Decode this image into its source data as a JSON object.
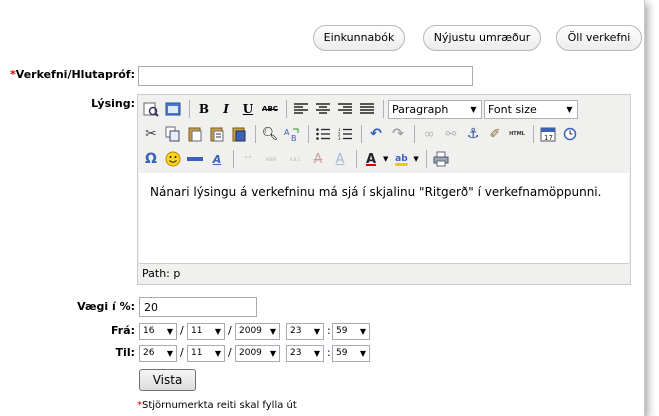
{
  "nav": {
    "gradebook": "Einkunnabók",
    "latest_discussions": "Nýjustu umræður",
    "all_assignments": "Öll verkefni"
  },
  "form": {
    "required_marker": "*",
    "assignment_label": "Verkefni/Hlutapróf:",
    "assignment_value": "",
    "description_label": "Lýsing:",
    "weight_label": "Vægi í %:",
    "weight_value": "20",
    "from_label": "Frá:",
    "to_label": "Til:",
    "from": {
      "day": "16",
      "month": "11",
      "year": "2009",
      "hour": "23",
      "minute": "59"
    },
    "to": {
      "day": "26",
      "month": "11",
      "year": "2009",
      "hour": "23",
      "minute": "59"
    },
    "date_separator": "/",
    "time_separator": ":",
    "submit_label": "Vista",
    "required_note": "Stjörnumerkta reiti skal fylla út"
  },
  "editor": {
    "format_select": "Paragraph",
    "fontsize_select": "Font size",
    "content": "Nánari lýsingu á verkefninu má sjá í skjalinu \"Ritgerð\" í verkefnamöppunni.",
    "path_label": "Path: p",
    "toolbar_text": {
      "bold": "B",
      "italic": "I",
      "underline": "U",
      "strike": "ABC",
      "html": "HTML",
      "omega": "Ω",
      "quote": "“”",
      "abbr": "ABBR",
      "acronym": "A.B.C",
      "fontcolor": "A",
      "backcolor": "ab"
    }
  },
  "colors": {
    "required": "#dd0000",
    "toolbar_bg": "#f0f0ee"
  }
}
